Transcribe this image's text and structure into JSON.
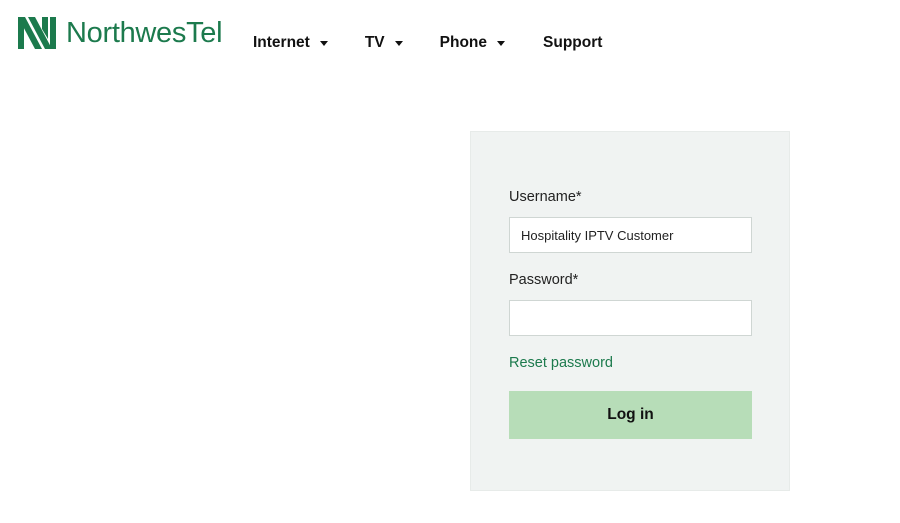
{
  "header": {
    "logo_text": "NorthwesTel",
    "nav": [
      {
        "label": "Internet",
        "has_dropdown": true
      },
      {
        "label": "TV",
        "has_dropdown": true
      },
      {
        "label": "Phone",
        "has_dropdown": true
      },
      {
        "label": "Support",
        "has_dropdown": false
      }
    ]
  },
  "login": {
    "username_label": "Username*",
    "username_value": "Hospitality IPTV Customer",
    "password_label": "Password*",
    "password_value": "",
    "reset_link": "Reset password",
    "login_button": "Log in"
  },
  "colors": {
    "brand": "#1c7a4d",
    "panel_bg": "#f0f3f2",
    "button_bg": "#b7ddb8"
  },
  "icons": {
    "logo_mark": "northwestel-logo-icon",
    "dropdown": "caret-down-icon"
  }
}
